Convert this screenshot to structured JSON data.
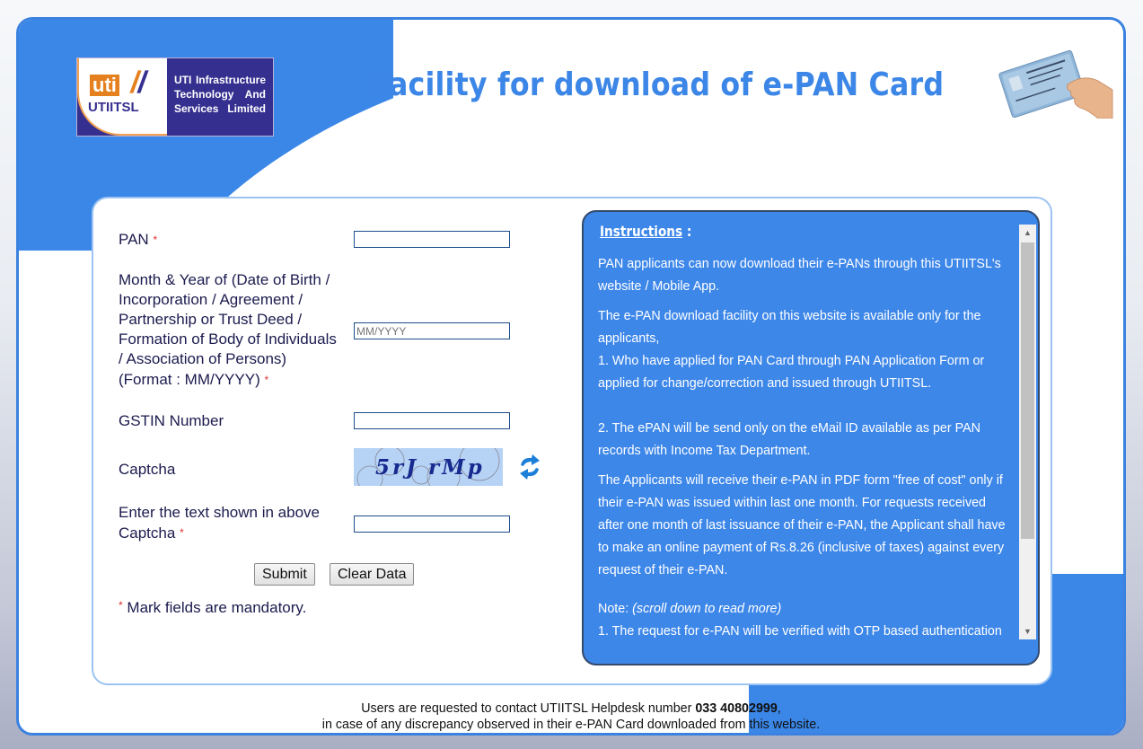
{
  "header": {
    "logo": {
      "mark": "uti",
      "abbr": "UTIITSL",
      "company_lines": [
        "UTI Infrastructure",
        "Technology And",
        "Services Limited"
      ]
    },
    "title": "Facility for download of e-PAN Card",
    "image_alt": "PAN card in hand"
  },
  "form": {
    "fields": [
      {
        "label": "PAN",
        "required": true,
        "value": "",
        "placeholder": ""
      },
      {
        "label_lines": [
          "Month & Year of (Date of Birth /",
          "Incorporation / Agreement /",
          "Partnership or Trust Deed /",
          "Formation of Body of Individuals",
          "/ Association of Persons)",
          "(Format : MM/YYYY)"
        ],
        "required": true,
        "value": "",
        "placeholder": "MM/YYYY"
      },
      {
        "label": "GSTIN Number",
        "required": false,
        "value": "",
        "placeholder": ""
      },
      {
        "label": "Captcha",
        "captcha_text": "5rJ rMp"
      },
      {
        "label_lines": [
          "Enter the text shown in above",
          "Captcha"
        ],
        "required": true,
        "value": "",
        "placeholder": ""
      }
    ],
    "required_marker": "*",
    "submit_label": "Submit",
    "clear_label": "Clear Data",
    "mandatory_note": "Mark fields are mandatory."
  },
  "instructions": {
    "heading": "Instructions",
    "heading_suffix": " :",
    "paragraphs": [
      "PAN applicants can now download their e-PANs through this UTIITSL's website / Mobile App.",
      "The e-PAN download facility on this website is available only for the applicants,",
      "1. Who have applied for PAN Card through PAN Application Form or applied for change/correction and issued through UTIITSL.",
      "2. The ePAN will be send only on the eMail ID available as per PAN records with Income Tax Department.",
      "The Applicants will receive their e-PAN in PDF form \"free of cost\" only if their e-PAN was issued within last one month. For requests received after one month of last issuance of their e-PAN, the Applicant shall have to make an online payment of Rs.8.26 (inclusive of taxes) against every request of their e-PAN."
    ],
    "note_label": "Note:",
    "note_hint": "(scroll down to read more)",
    "note_items": [
      "1. The request for e-PAN will be verified with OTP based authentication"
    ]
  },
  "footer": {
    "line1_prefix": "Users are requested to contact UTIITSL Helpdesk number ",
    "helpdesk_number": "033 40802999",
    "line1_suffix": ",",
    "line2": "in case of any discrepancy observed in their e-PAN Card downloaded from this website."
  },
  "colors": {
    "accent_blue": "#3b87e8",
    "panel_border": "#9cc3f2",
    "instructions_bg": "#3d87e9",
    "label_text": "#1c1b4e",
    "required_red": "#e03030"
  }
}
